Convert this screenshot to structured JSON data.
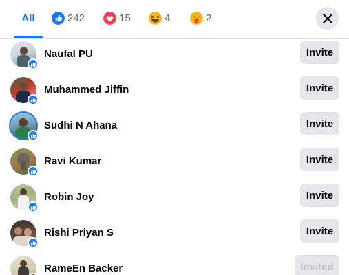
{
  "tabs": [
    {
      "label": "All",
      "active": true
    },
    {
      "icon": "like-icon",
      "count": "242",
      "color": "#1877f2"
    },
    {
      "icon": "love-icon",
      "count": "15",
      "color": "#f33e58"
    },
    {
      "icon": "haha-icon",
      "count": "4",
      "color": "#f7b125"
    },
    {
      "icon": "care-icon",
      "count": "2",
      "color": "#f7b125"
    }
  ],
  "close_icon": "close-icon",
  "people": [
    {
      "name": "Naufal PU",
      "action": "Invite",
      "avatar_colors": [
        "#cfd6dc",
        "#7f8c95"
      ]
    },
    {
      "name": "Muhammed Jiffin",
      "action": "Invite",
      "avatar_colors": [
        "#c0392b",
        "#2c6e49"
      ]
    },
    {
      "name": "Sudhi N Ahana",
      "action": "Invite",
      "avatar_colors": [
        "#7aa6c2",
        "#3b5b3a"
      ]
    },
    {
      "name": "Ravi Kumar",
      "action": "Invite",
      "avatar_colors": [
        "#a7794c",
        "#4b6b3a"
      ]
    },
    {
      "name": "Robin Joy",
      "action": "Invite",
      "avatar_colors": [
        "#9fb27f",
        "#d9d4c7"
      ]
    },
    {
      "name": "Rishi Priyan S",
      "action": "Invite",
      "avatar_colors": [
        "#3a2f2a",
        "#8a6b57"
      ]
    },
    {
      "name": "RameEn Backer",
      "action": "Invited",
      "avatar_colors": [
        "#c8b79a",
        "#e9e2d6"
      ]
    }
  ],
  "accent": "#1877f2"
}
